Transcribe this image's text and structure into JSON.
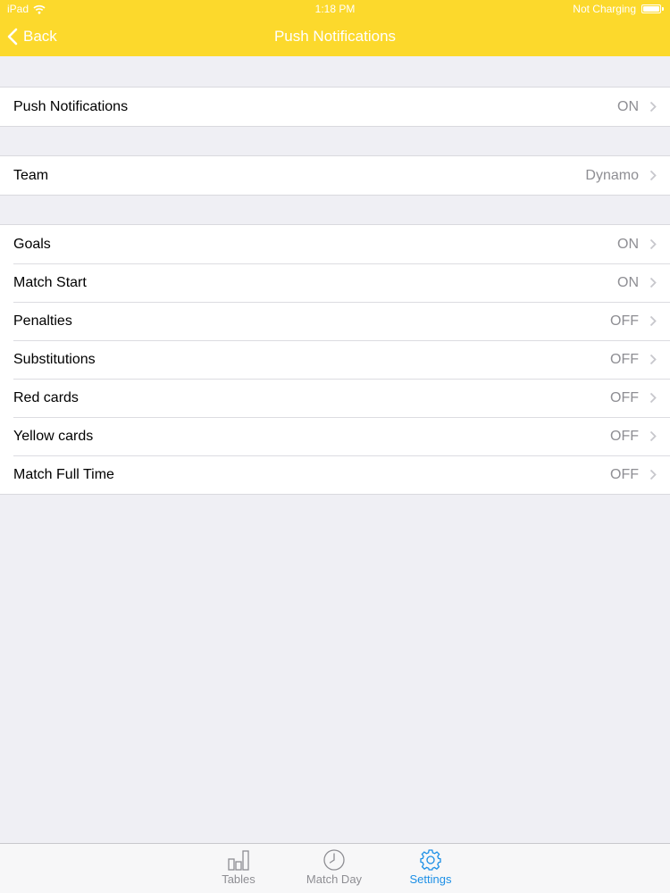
{
  "status_bar": {
    "device": "iPad",
    "time": "1:18 PM",
    "battery_text": "Not Charging"
  },
  "nav": {
    "back_label": "Back",
    "title": "Push Notifications"
  },
  "groups": [
    {
      "rows": [
        {
          "label": "Push Notifications",
          "value": "ON"
        }
      ]
    },
    {
      "rows": [
        {
          "label": "Team",
          "value": "Dynamo"
        }
      ]
    },
    {
      "rows": [
        {
          "label": "Goals",
          "value": "ON"
        },
        {
          "label": "Match Start",
          "value": "ON"
        },
        {
          "label": "Penalties",
          "value": "OFF"
        },
        {
          "label": "Substitutions",
          "value": "OFF"
        },
        {
          "label": "Red cards",
          "value": "OFF"
        },
        {
          "label": "Yellow cards",
          "value": "OFF"
        },
        {
          "label": "Match Full Time",
          "value": "OFF"
        }
      ]
    }
  ],
  "tab_bar": {
    "tabs": [
      {
        "label": "Tables",
        "icon": "bar-chart-icon",
        "active": false
      },
      {
        "label": "Match Day",
        "icon": "clock-icon",
        "active": false
      },
      {
        "label": "Settings",
        "icon": "gear-icon",
        "active": true
      }
    ]
  },
  "colors": {
    "nav_background": "#fcd92c",
    "active_tab": "#1c8fe6",
    "page_background": "#efeff4"
  }
}
